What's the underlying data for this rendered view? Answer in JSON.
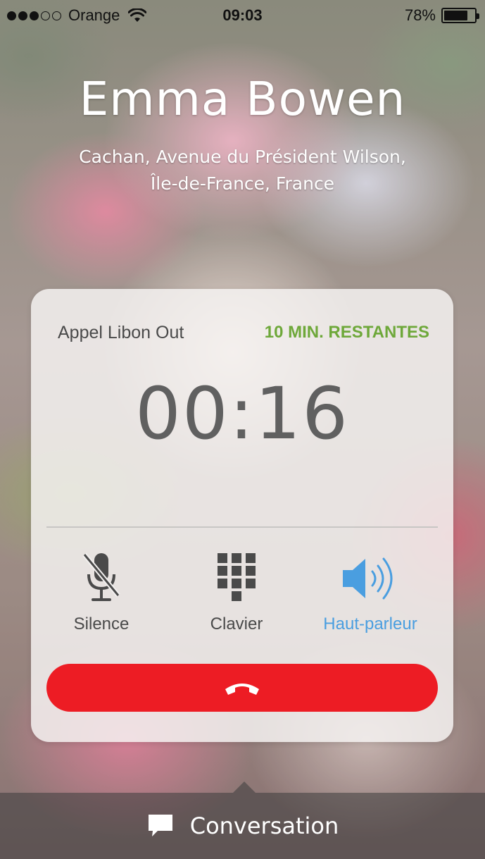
{
  "status_bar": {
    "carrier": "Orange",
    "signal_bars_filled": 3,
    "signal_bars_total": 5,
    "time": "09:03",
    "battery_percent": "78%",
    "battery_level": 0.78
  },
  "caller": {
    "name": "Emma Bowen",
    "location_line1": "Cachan, Avenue du Président Wilson,",
    "location_line2": "Île-de-France, France"
  },
  "call_card": {
    "service": "Appel Libon Out",
    "remaining": "10 MIN. RESTANTES",
    "timer": "00:16",
    "controls": {
      "mute_label": "Silence",
      "keypad_label": "Clavier",
      "speaker_label": "Haut-parleur"
    }
  },
  "conversation": {
    "label": "Conversation"
  },
  "colors": {
    "accent_green": "#6ea83a",
    "speaker_blue": "#4a9ee0",
    "end_call_red": "#ed1c24"
  },
  "icons": {
    "mute": "microphone-off-icon",
    "keypad": "keypad-icon",
    "speaker": "speaker-icon",
    "end_call": "hang-up-phone-icon",
    "conversation": "chat-bubble-icon",
    "wifi": "wifi-icon",
    "battery": "battery-icon"
  }
}
